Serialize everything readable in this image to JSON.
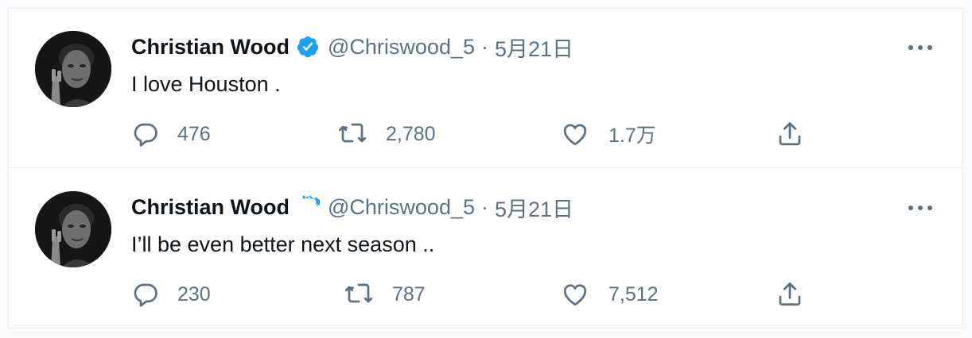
{
  "tweets": [
    {
      "author_name": "Christian Wood",
      "handle": "@Chriswood_5",
      "separator": "·",
      "date": "5月21日",
      "text": "I love Houston .",
      "replies": "476",
      "retweets": "2,780",
      "likes": "1.7万"
    },
    {
      "author_name": "Christian Wood",
      "handle": "@Chriswood_5",
      "separator": "·",
      "date": "5月21日",
      "text": "I’ll be even better next season ..",
      "replies": "230",
      "retweets": "787",
      "likes": "7,512"
    }
  ],
  "colors": {
    "verified": "#1da1f2",
    "text": "#0f1419",
    "secondary": "#5b7083",
    "divider": "#e6ecf0"
  },
  "icons": {
    "verified": "verified-badge-icon",
    "more": "more-options-icon",
    "reply": "reply-icon",
    "retweet": "retweet-icon",
    "like": "heart-icon",
    "share": "share-icon"
  }
}
